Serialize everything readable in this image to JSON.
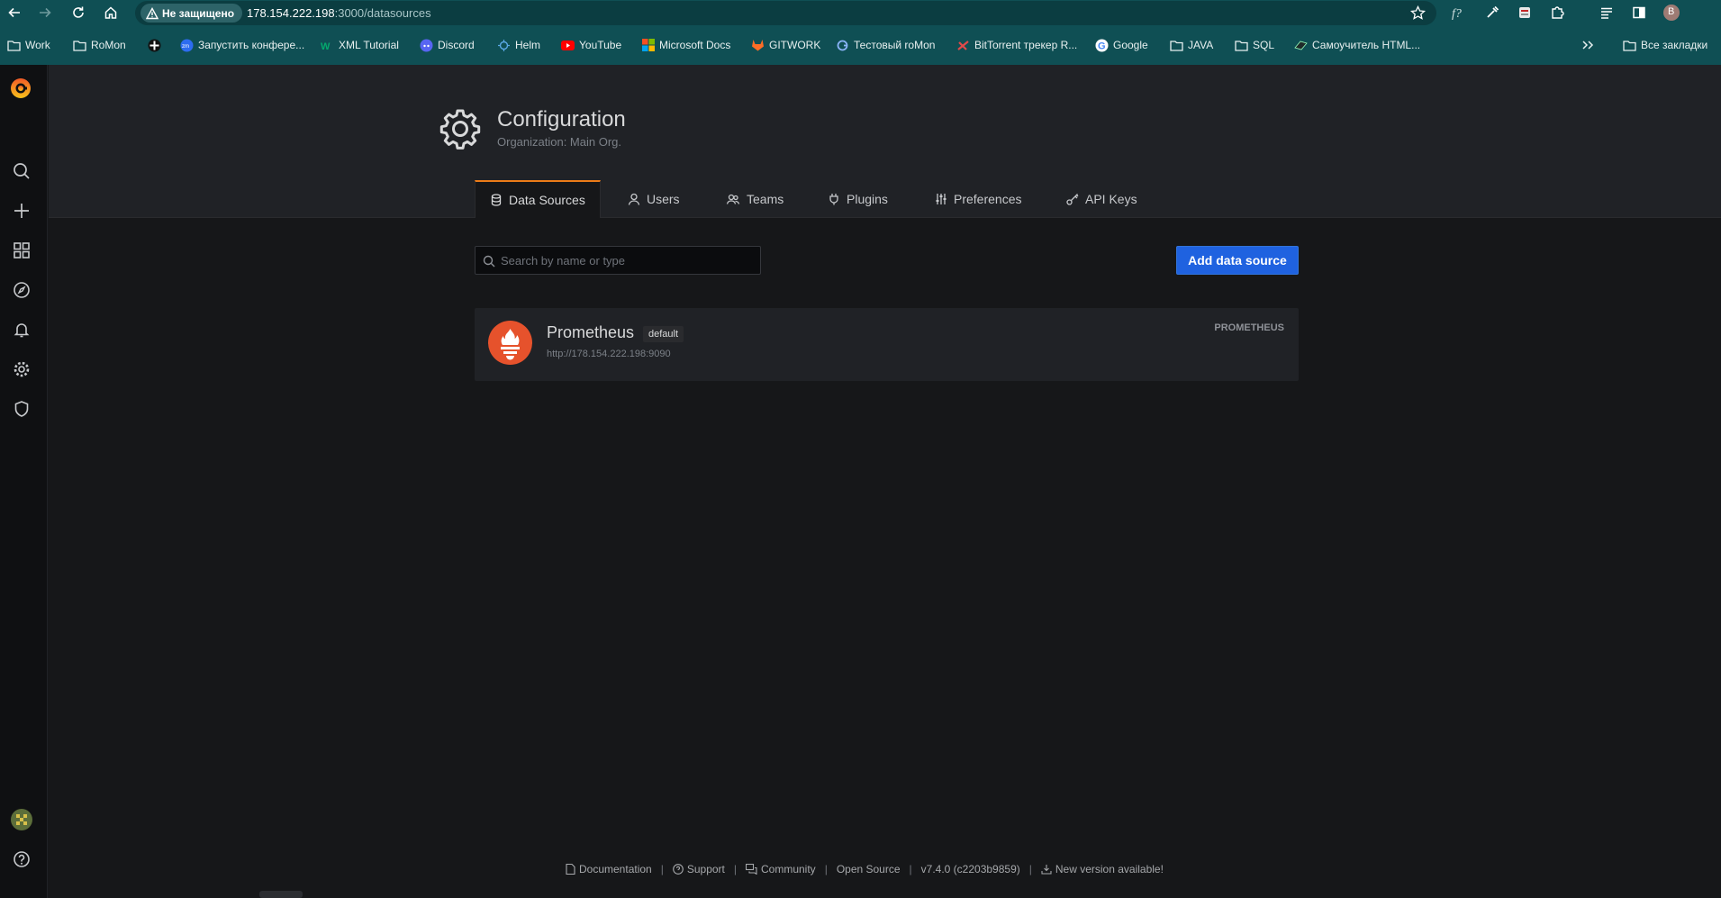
{
  "browser": {
    "security_label": "Не защищено",
    "url_host": "178.154.222.198",
    "url_rest": ":3000/datasources",
    "profile_initial": "В",
    "bookmarks": [
      {
        "label": "Work",
        "icon": "folder-icon"
      },
      {
        "label": "RoMon",
        "icon": "folder-icon"
      },
      {
        "label": "",
        "icon": "sparkle-icon"
      },
      {
        "label": "Запустить конфере...",
        "icon": "zoom-icon"
      },
      {
        "label": "XML Tutorial",
        "icon": "w3schools-icon"
      },
      {
        "label": "Discord",
        "icon": "discord-icon"
      },
      {
        "label": "Helm",
        "icon": "helm-icon"
      },
      {
        "label": "YouTube",
        "icon": "youtube-icon"
      },
      {
        "label": "Microsoft Docs",
        "icon": "microsoft-icon"
      },
      {
        "label": "GITWORK",
        "icon": "gitlab-icon"
      },
      {
        "label": "Тестовый roMon",
        "icon": "grafana-small-icon"
      },
      {
        "label": "BitTorrent трекер R...",
        "icon": "bittorrent-icon"
      },
      {
        "label": "Google",
        "icon": "google-icon"
      },
      {
        "label": "JAVA",
        "icon": "folder-icon"
      },
      {
        "label": "SQL",
        "icon": "folder-icon"
      },
      {
        "label": "Самоучитель HTML...",
        "icon": "html-icon"
      }
    ],
    "all_bookmarks": "Все закладки",
    "colors": {
      "frame": "#0f4f54",
      "omnibox": "#0b3d41"
    }
  },
  "page": {
    "title": "Configuration",
    "subtitle": "Organization: Main Org.",
    "tabs": [
      {
        "label": "Data Sources",
        "icon": "database-icon",
        "active": true
      },
      {
        "label": "Users",
        "icon": "user-icon",
        "active": false
      },
      {
        "label": "Teams",
        "icon": "users-icon",
        "active": false
      },
      {
        "label": "Plugins",
        "icon": "plug-icon",
        "active": false
      },
      {
        "label": "Preferences",
        "icon": "sliders-icon",
        "active": false
      },
      {
        "label": "API Keys",
        "icon": "key-icon",
        "active": false
      }
    ],
    "search_placeholder": "Search by name or type",
    "add_button": "Add data source",
    "datasources": [
      {
        "name": "Prometheus",
        "badge": "default",
        "url": "http://178.154.222.198:9090",
        "type": "PROMETHEUS"
      }
    ],
    "colors": {
      "accent": "#eb7b18",
      "primary_button": "#1f62e0",
      "prometheus": "#e6522c"
    }
  },
  "footer": {
    "documentation": "Documentation",
    "support": "Support",
    "community": "Community",
    "open_source": "Open Source",
    "version": "v7.4.0 (c2203b9859)",
    "new_version": "New version available!"
  }
}
